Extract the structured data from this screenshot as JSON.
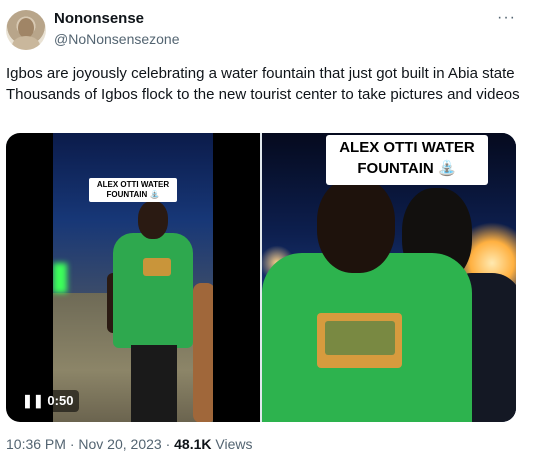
{
  "author": {
    "name": "Nononsense",
    "handle": "@NoNonsensezone"
  },
  "tweet": {
    "text": "Igbos are joyously celebrating a water fountain that just got built in Abia state Thousands of Igbos flock to the new tourist center to take pictures and videos"
  },
  "media": {
    "left_caption": "ALEX OTTI WATER FOUNTAIN ⛲",
    "right_caption": "ALEX OTTI WATER FOUNTAIN ⛲",
    "duration": "0:50"
  },
  "footer": {
    "time": "10:36 PM",
    "date": "Nov 20, 2023",
    "views_count": "48.1K",
    "views_label": "Views",
    "separator": "·"
  },
  "icons": {
    "more": "more-icon",
    "pause": "pause-icon",
    "fountain": "fountain-emoji"
  }
}
